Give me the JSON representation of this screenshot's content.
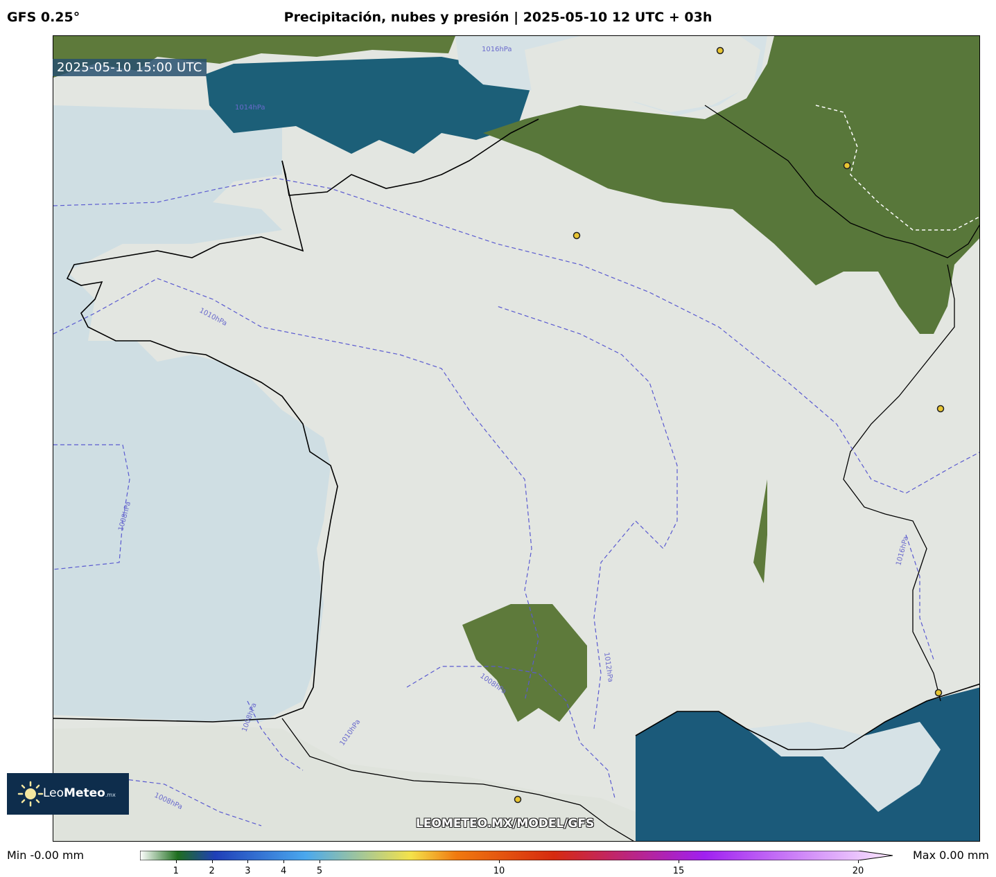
{
  "header": {
    "model": "GFS 0.25°",
    "title": "Precipitación, nubes y presión | 2025-05-10 12 UTC + 03h"
  },
  "map": {
    "valid_time": "2025-05-10 15:00 UTC",
    "watermark": "LEOMETEO.MX/MODEL/GFS",
    "isobar_labels": [
      "1016hPa",
      "1014hPa",
      "1010hPa",
      "1008hPa",
      "1012hPa",
      "1008hPa",
      "1008hPa",
      "1010hPa",
      "1008hPa",
      "1016hPa"
    ],
    "colors": {
      "sea": "#1a5f7a",
      "land": "#5b7a3a",
      "cloud": "#e4e7e2",
      "isobar": "#5a5ad0"
    }
  },
  "logo": {
    "name_part1": "Leo",
    "name_part2": "Meteo",
    "suffix": ".mx"
  },
  "colorbar": {
    "min_label": "Min -0.00 mm",
    "max_label": "Max 0.00 mm",
    "ticks": [
      "1",
      "2",
      "3",
      "4",
      "5",
      "10",
      "15",
      "20"
    ],
    "stops": [
      "#ffffff",
      "#1e6e1e",
      "#1f3fb8",
      "#4aa8ee",
      "#f4e24a",
      "#f07a10",
      "#d62a10",
      "#a020f0",
      "#fbe9ff"
    ]
  }
}
